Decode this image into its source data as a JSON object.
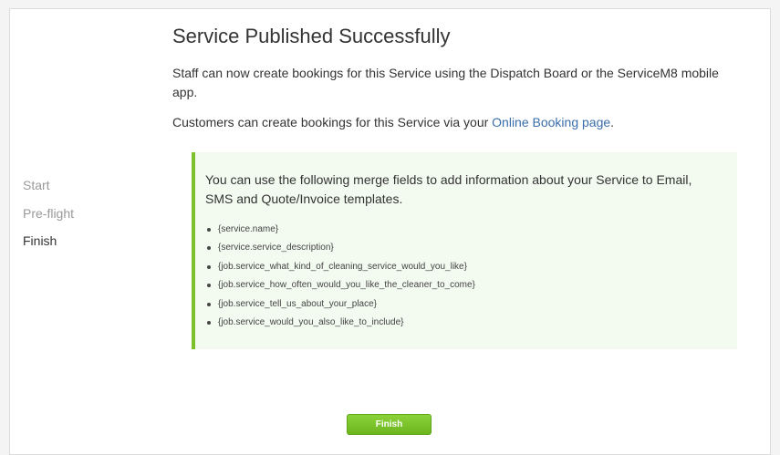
{
  "sidebar": {
    "steps": [
      {
        "label": "Start"
      },
      {
        "label": "Pre-flight"
      },
      {
        "label": "Finish"
      }
    ]
  },
  "main": {
    "title": "Service Published Successfully",
    "staff_text": "Staff can now create bookings for this Service using the Dispatch Board or the ServiceM8 mobile app.",
    "customers_text": "Customers can create bookings for this Service via your ",
    "booking_link": "Online Booking page",
    "customers_suffix": "."
  },
  "merge_fields": {
    "intro": "You can use the following merge fields to add information about your Service to Email, SMS and Quote/Invoice templates.",
    "items": [
      "{service.name}",
      "{service.service_description}",
      "{job.service_what_kind_of_cleaning_service_would_you_like}",
      "{job.service_how_often_would_you_like_the_cleaner_to_come}",
      "{job.service_tell_us_about_your_place}",
      "{job.service_would_you_also_like_to_include}"
    ]
  },
  "footer": {
    "finish_label": "Finish"
  },
  "colors": {
    "accent_green": "#7cc12b",
    "link_blue": "#3a6daa",
    "merge_box_bg": "#f3faf0"
  }
}
